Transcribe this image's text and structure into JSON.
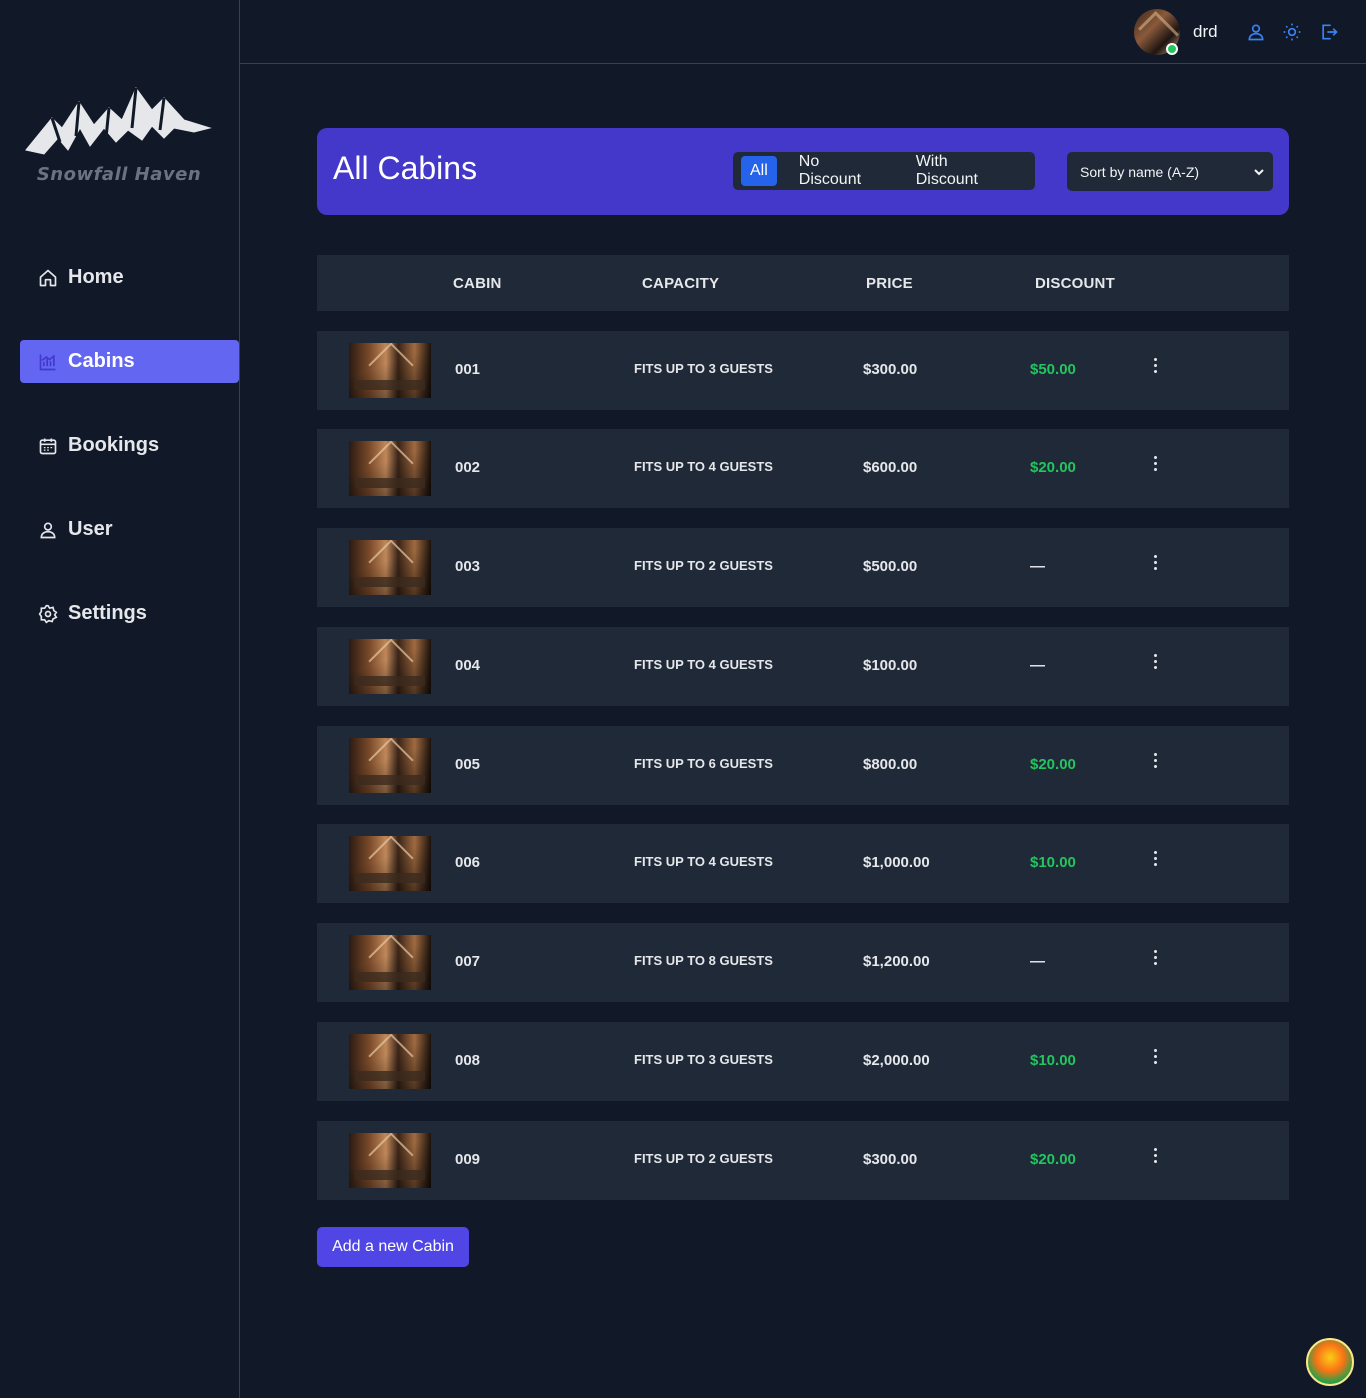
{
  "brand": {
    "name": "Snowfall Haven"
  },
  "sidebar": {
    "items": [
      {
        "label": "Home",
        "icon": "home-icon",
        "active": false
      },
      {
        "label": "Cabins",
        "icon": "chart-icon",
        "active": true
      },
      {
        "label": "Bookings",
        "icon": "calendar-icon",
        "active": false
      },
      {
        "label": "User",
        "icon": "user-icon",
        "active": false
      },
      {
        "label": "Settings",
        "icon": "gear-icon",
        "active": false
      }
    ]
  },
  "header": {
    "username": "drd",
    "icons": [
      "user-icon",
      "sun-icon",
      "logout-icon"
    ]
  },
  "main": {
    "title": "All Cabins",
    "filters": {
      "all": "All",
      "no_discount": "No Discount",
      "with_discount": "With Discount",
      "selected": "All"
    },
    "sort": {
      "selected": "Sort by name (A-Z)"
    },
    "table": {
      "headers": {
        "cabin": "CABIN",
        "capacity": "CAPACITY",
        "price": "PRICE",
        "discount": "DISCOUNT"
      },
      "rows": [
        {
          "name": "001",
          "capacity": "FITS UP TO 3 GUESTS",
          "price": "$300.00",
          "discount": "$50.00"
        },
        {
          "name": "002",
          "capacity": "FITS UP TO 4 GUESTS",
          "price": "$600.00",
          "discount": "$20.00"
        },
        {
          "name": "003",
          "capacity": "FITS UP TO 2 GUESTS",
          "price": "$500.00",
          "discount": "—"
        },
        {
          "name": "004",
          "capacity": "FITS UP TO 4 GUESTS",
          "price": "$100.00",
          "discount": "—"
        },
        {
          "name": "005",
          "capacity": "FITS UP TO 6 GUESTS",
          "price": "$800.00",
          "discount": "$20.00"
        },
        {
          "name": "006",
          "capacity": "FITS UP TO 4 GUESTS",
          "price": "$1,000.00",
          "discount": "$10.00"
        },
        {
          "name": "007",
          "capacity": "FITS UP TO 8 GUESTS",
          "price": "$1,200.00",
          "discount": "—"
        },
        {
          "name": "008",
          "capacity": "FITS UP TO 3 GUESTS",
          "price": "$2,000.00",
          "discount": "$10.00"
        },
        {
          "name": "009",
          "capacity": "FITS UP TO 2 GUESTS",
          "price": "$300.00",
          "discount": "$20.00"
        }
      ]
    },
    "add_button": "Add a new Cabin"
  },
  "colors": {
    "background": "#111827",
    "panel": "#1f2937",
    "accent": "#4338ca",
    "active_nav": "#6366f1",
    "discount_green": "#22c55e",
    "icon_blue": "#3b82f6"
  }
}
